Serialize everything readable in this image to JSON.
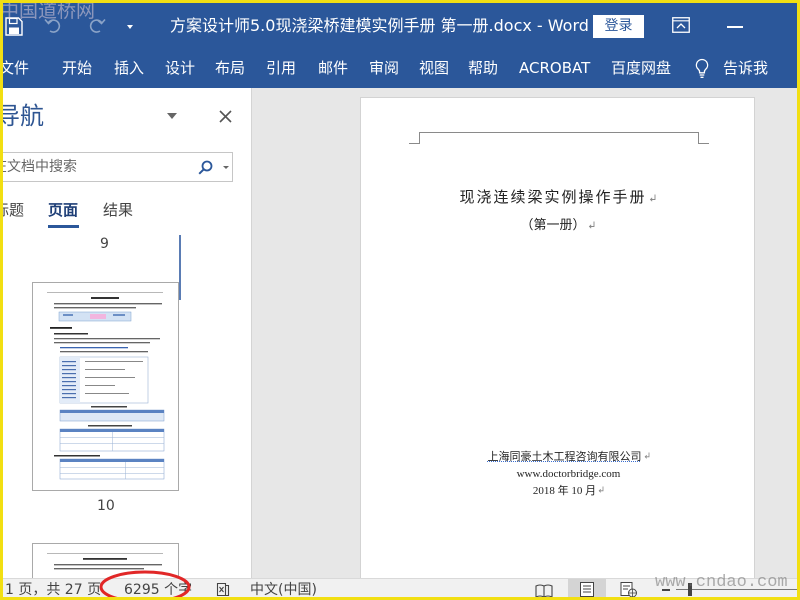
{
  "window": {
    "title": "方案设计师5.0现浇梁桥建模实例手册 第一册.docx - Word",
    "login_label": "登录",
    "watermark_top": "中国道桥网",
    "watermark_bottom": "www.cndao.com",
    "colors": {
      "accent": "#2b579a",
      "frame": "#f2df12",
      "annotation_circle": "#e12727",
      "document_background": "#e7e7e7"
    }
  },
  "quick_access_toolbar": {
    "icons": [
      "save-icon",
      "undo-icon",
      "redo-icon",
      "customize-dropdown-icon"
    ]
  },
  "window_controls": {
    "icons": [
      "ribbon-display-options-icon",
      "minimize-icon"
    ]
  },
  "ribbon": {
    "tabs": [
      "文件",
      "开始",
      "插入",
      "设计",
      "布局",
      "引用",
      "邮件",
      "审阅",
      "视图",
      "帮助",
      "ACROBAT",
      "百度网盘"
    ],
    "tell_me_icon": "lightbulb-icon",
    "tell_me_label": "告诉我"
  },
  "navigation_pane": {
    "title": "导航",
    "search_placeholder": "在文档中搜索",
    "tabs": [
      "标题",
      "页面",
      "结果"
    ],
    "page_labels": [
      "9",
      "10"
    ]
  },
  "document": {
    "title": "现浇连续梁实例操作手册",
    "subtitle": "（第一册）",
    "company": "上海同豪土木工程咨询有限公司",
    "website": "www.doctorbridge.com",
    "date": "2018 年 10 月"
  },
  "status_bar": {
    "page_info": "1 页，共 27 页",
    "word_count": "6295 个字",
    "language": "中文(中国)",
    "views": [
      "read-mode-icon",
      "print-layout-icon",
      "web-layout-icon"
    ],
    "active_view": "print-layout-icon"
  }
}
